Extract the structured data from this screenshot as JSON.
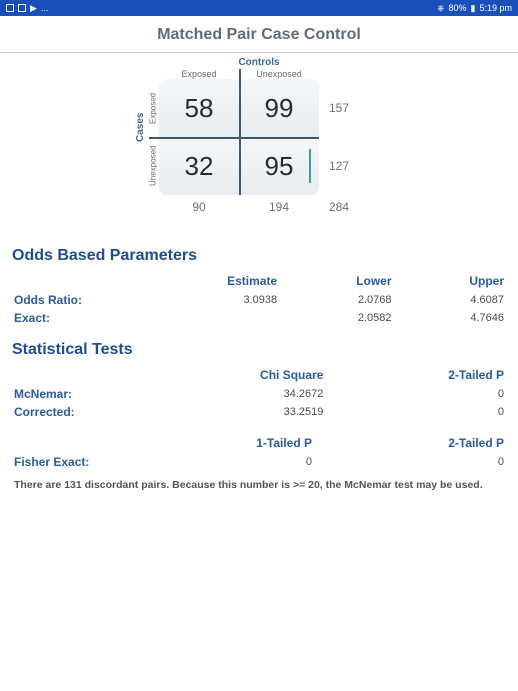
{
  "statusbar": {
    "dots": "...",
    "battery": "80%",
    "time": "5:19 pm"
  },
  "title": "Matched Pair Case Control",
  "grid": {
    "top_label": "Controls",
    "col_exposed": "Exposed",
    "col_unexposed": "Unexposed",
    "side_label": "Cases",
    "row_exposed": "Exposed",
    "row_unexposed": "Unexposed",
    "a": "58",
    "b": "99",
    "c": "32",
    "d": "95",
    "row1_total": "157",
    "row2_total": "127",
    "col1_total": "90",
    "col2_total": "194",
    "grand_total": "284"
  },
  "odds": {
    "heading": "Odds Based Parameters",
    "h_estimate": "Estimate",
    "h_lower": "Lower",
    "h_upper": "Upper",
    "rows": [
      {
        "label": "Odds Ratio:",
        "estimate": "3.0938",
        "lower": "2.0768",
        "upper": "4.6087"
      },
      {
        "label": "Exact:",
        "estimate": "",
        "lower": "2.0582",
        "upper": "4.7646"
      }
    ]
  },
  "stats": {
    "heading": "Statistical Tests",
    "h_chi": "Chi Square",
    "h_2p": "2-Tailed P",
    "rows1": [
      {
        "label": "McNemar:",
        "chi": "34.2672",
        "p2": "0"
      },
      {
        "label": "Corrected:",
        "chi": "33.2519",
        "p2": "0"
      }
    ],
    "h_1p": "1-Tailed P",
    "h_2p_b": "2-Tailed P",
    "rows2": [
      {
        "label": "Fisher Exact:",
        "p1": "0",
        "p2": "0"
      }
    ]
  },
  "note": "There are 131 discordant pairs.  Because this number is >= 20, the McNemar test may be used."
}
